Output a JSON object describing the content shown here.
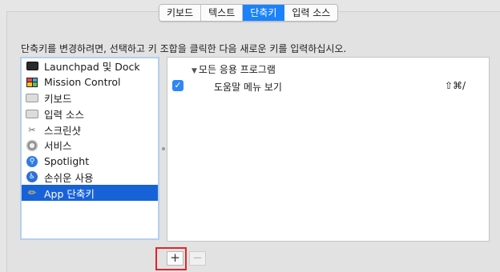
{
  "tabs": [
    {
      "label": "키보드"
    },
    {
      "label": "텍스트"
    },
    {
      "label": "단축키",
      "active": true
    },
    {
      "label": "입력 소스"
    }
  ],
  "instructions": "단축키를 변경하려면, 선택하고 키 조합을 클릭한 다음 새로운 키를 입력하십시오.",
  "sidebar": {
    "items": [
      {
        "label": "Launchpad 및 Dock",
        "icon": "launchpad-icon"
      },
      {
        "label": "Mission Control",
        "icon": "mission-control-icon"
      },
      {
        "label": "키보드",
        "icon": "keyboard-icon"
      },
      {
        "label": "입력 소스",
        "icon": "keyboard-icon"
      },
      {
        "label": "스크린샷",
        "icon": "screenshot-icon"
      },
      {
        "label": "서비스",
        "icon": "gear-icon"
      },
      {
        "label": "Spotlight",
        "icon": "spotlight-icon"
      },
      {
        "label": "손쉬운 사용",
        "icon": "accessibility-icon"
      },
      {
        "label": "App 단축키",
        "icon": "app-shortcuts-icon",
        "selected": true
      }
    ]
  },
  "shortcuts": {
    "group_label": "모든 응용 프로그램",
    "rows": [
      {
        "checked": true,
        "label": "도움말 메뉴 보기",
        "keys": "⇧⌘/"
      }
    ]
  },
  "buttons": {
    "add_label": "+",
    "remove_label": "−"
  },
  "colors": {
    "accent": "#1a82fb",
    "selection": "#1862d8",
    "highlight_box": "#e3242b"
  }
}
